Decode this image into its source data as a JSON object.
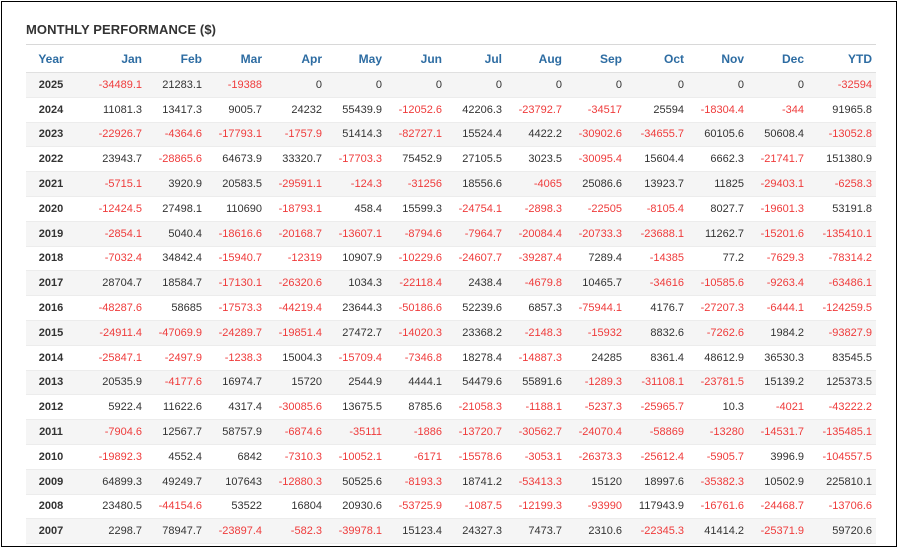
{
  "title": "MONTHLY PERFORMANCE ($)",
  "colors": {
    "header": "#2d6ca2",
    "negative": "#ef3b3b",
    "text": "#333333"
  },
  "headers": [
    "Year",
    "Jan",
    "Feb",
    "Mar",
    "Apr",
    "May",
    "Jun",
    "Jul",
    "Aug",
    "Sep",
    "Oct",
    "Nov",
    "Dec",
    "YTD"
  ],
  "rows": [
    [
      "2025",
      "-34489.1",
      "21283.1",
      "-19388",
      "0",
      "0",
      "0",
      "0",
      "0",
      "0",
      "0",
      "0",
      "0",
      "-32594"
    ],
    [
      "2024",
      "11081.3",
      "13417.3",
      "9005.7",
      "24232",
      "55439.9",
      "-12052.6",
      "42206.3",
      "-23792.7",
      "-34517",
      "25594",
      "-18304.4",
      "-344",
      "91965.8"
    ],
    [
      "2023",
      "-22926.7",
      "-4364.6",
      "-17793.1",
      "-1757.9",
      "51414.3",
      "-82727.1",
      "15524.4",
      "4422.2",
      "-30902.6",
      "-34655.7",
      "60105.6",
      "50608.4",
      "-13052.8"
    ],
    [
      "2022",
      "23943.7",
      "-28865.6",
      "64673.9",
      "33320.7",
      "-17703.3",
      "75452.9",
      "27105.5",
      "3023.5",
      "-30095.4",
      "15604.4",
      "6662.3",
      "-21741.7",
      "151380.9"
    ],
    [
      "2021",
      "-5715.1",
      "3920.9",
      "20583.5",
      "-29591.1",
      "-124.3",
      "-31256",
      "18556.6",
      "-4065",
      "25086.6",
      "13923.7",
      "11825",
      "-29403.1",
      "-6258.3"
    ],
    [
      "2020",
      "-12424.5",
      "27498.1",
      "110690",
      "-18793.1",
      "458.4",
      "15599.3",
      "-24754.1",
      "-2898.3",
      "-22505",
      "-8105.4",
      "8027.7",
      "-19601.3",
      "53191.8"
    ],
    [
      "2019",
      "-2854.1",
      "5040.4",
      "-18616.6",
      "-20168.7",
      "-13607.1",
      "-8794.6",
      "-7964.7",
      "-20084.4",
      "-20733.3",
      "-23688.1",
      "11262.7",
      "-15201.6",
      "-135410.1"
    ],
    [
      "2018",
      "-7032.4",
      "34842.4",
      "-15940.7",
      "-12319",
      "10907.9",
      "-10229.6",
      "-24607.7",
      "-39287.4",
      "7289.4",
      "-14385",
      "77.2",
      "-7629.3",
      "-78314.2"
    ],
    [
      "2017",
      "28704.7",
      "18584.7",
      "-17130.1",
      "-26320.6",
      "1034.3",
      "-22118.4",
      "2438.4",
      "-4679.8",
      "10465.7",
      "-34616",
      "-10585.6",
      "-9263.4",
      "-63486.1"
    ],
    [
      "2016",
      "-48287.6",
      "58685",
      "-17573.3",
      "-44219.4",
      "23644.3",
      "-50186.6",
      "52239.6",
      "6857.3",
      "-75944.1",
      "4176.7",
      "-27207.3",
      "-6444.1",
      "-124259.5"
    ],
    [
      "2015",
      "-24911.4",
      "-47069.9",
      "-24289.7",
      "-19851.4",
      "27472.7",
      "-14020.3",
      "23368.2",
      "-2148.3",
      "-15932",
      "8832.6",
      "-7262.6",
      "1984.2",
      "-93827.9"
    ],
    [
      "2014",
      "-25847.1",
      "-2497.9",
      "-1238.3",
      "15004.3",
      "-15709.4",
      "-7346.8",
      "18278.4",
      "-14887.3",
      "24285",
      "8361.4",
      "48612.9",
      "36530.3",
      "83545.5"
    ],
    [
      "2013",
      "20535.9",
      "-4177.6",
      "16974.7",
      "15720",
      "2544.9",
      "4444.1",
      "54479.6",
      "55891.6",
      "-1289.3",
      "-31108.1",
      "-23781.5",
      "15139.2",
      "125373.5"
    ],
    [
      "2012",
      "5922.4",
      "11622.6",
      "4317.4",
      "-30085.6",
      "13675.5",
      "8785.6",
      "-21058.3",
      "-1188.1",
      "-5237.3",
      "-25965.7",
      "10.3",
      "-4021",
      "-43222.2"
    ],
    [
      "2011",
      "-7904.6",
      "12567.7",
      "58757.9",
      "-6874.6",
      "-35111",
      "-1886",
      "-13720.7",
      "-30562.7",
      "-24070.4",
      "-58869",
      "-13280",
      "-14531.7",
      "-135485.1"
    ],
    [
      "2010",
      "-19892.3",
      "4552.4",
      "6842",
      "-7310.3",
      "-10052.1",
      "-6171",
      "-15578.6",
      "-3053.1",
      "-26373.3",
      "-25612.4",
      "-5905.7",
      "3996.9",
      "-104557.5"
    ],
    [
      "2009",
      "64899.3",
      "49249.7",
      "107643",
      "-12880.3",
      "50525.6",
      "-8193.3",
      "18741.2",
      "-53413.3",
      "15120",
      "18997.6",
      "-35382.3",
      "10502.9",
      "225810.1"
    ],
    [
      "2008",
      "23480.5",
      "-44154.6",
      "53522",
      "16804",
      "20930.6",
      "-53725.9",
      "-1087.5",
      "-12199.3",
      "-93990",
      "117943.9",
      "-16761.6",
      "-24468.7",
      "-13706.6"
    ],
    [
      "2007",
      "2298.7",
      "78947.7",
      "-23897.4",
      "-582.3",
      "-39978.1",
      "15123.4",
      "24327.3",
      "7473.7",
      "2310.6",
      "-22345.3",
      "41414.2",
      "-25371.9",
      "59720.6"
    ]
  ]
}
